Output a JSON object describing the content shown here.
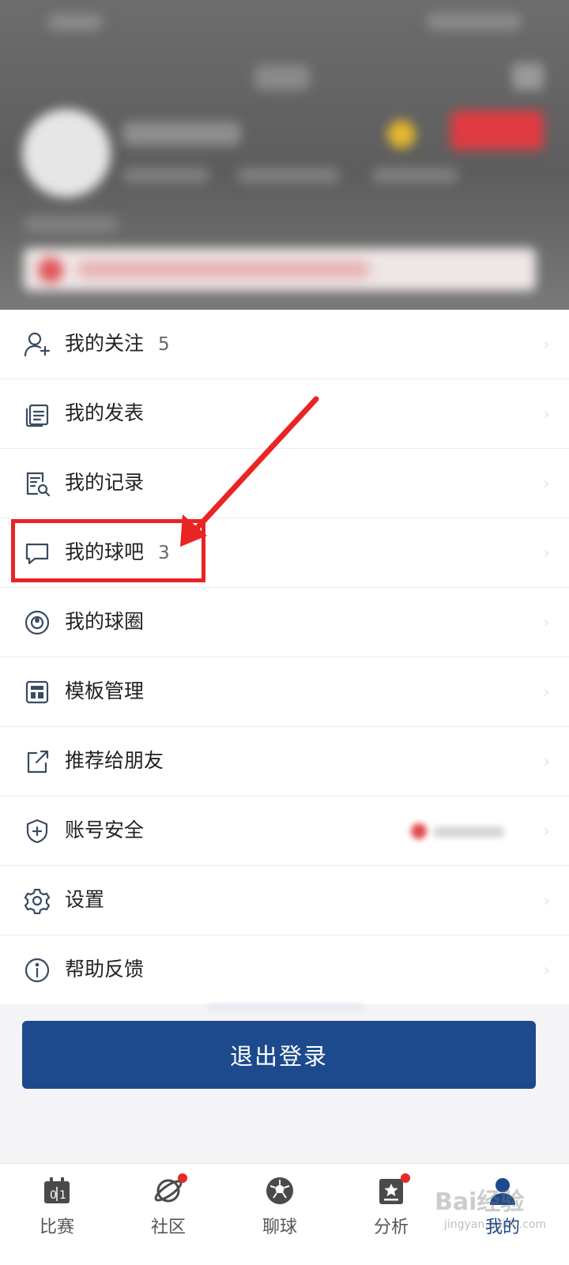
{
  "menu": {
    "items": [
      {
        "label": "我的关注",
        "count": "5",
        "icon": "user-add-icon"
      },
      {
        "label": "我的发表",
        "count": "",
        "icon": "documents-icon"
      },
      {
        "label": "我的记录",
        "count": "",
        "icon": "record-search-icon"
      },
      {
        "label": "我的球吧",
        "count": "3",
        "icon": "chat-bubble-icon"
      },
      {
        "label": "我的球圈",
        "count": "",
        "icon": "ball-circle-icon"
      },
      {
        "label": "模板管理",
        "count": "",
        "icon": "template-icon"
      },
      {
        "label": "推荐给朋友",
        "count": "",
        "icon": "share-icon"
      },
      {
        "label": "账号安全",
        "count": "",
        "icon": "shield-icon"
      },
      {
        "label": "设置",
        "count": "",
        "icon": "gear-icon"
      },
      {
        "label": "帮助反馈",
        "count": "",
        "icon": "info-icon"
      }
    ]
  },
  "logout": {
    "label": "退出登录"
  },
  "tabs": [
    {
      "label": "比赛",
      "icon": "scoreboard-icon",
      "badge": false,
      "active": false
    },
    {
      "label": "社区",
      "icon": "planet-icon",
      "badge": true,
      "active": false
    },
    {
      "label": "聊球",
      "icon": "football-icon",
      "badge": false,
      "active": false
    },
    {
      "label": "分析",
      "icon": "star-card-icon",
      "badge": true,
      "active": false
    },
    {
      "label": "我的",
      "icon": "profile-icon",
      "badge": false,
      "active": true
    }
  ],
  "watermark": {
    "main": "Bai经验",
    "sub": "jingyan.baidu.com"
  },
  "colors": {
    "accent": "#1d4a8c",
    "highlight": "#ea2424",
    "badge": "#e42a2a",
    "icon": "#3a4a62"
  }
}
